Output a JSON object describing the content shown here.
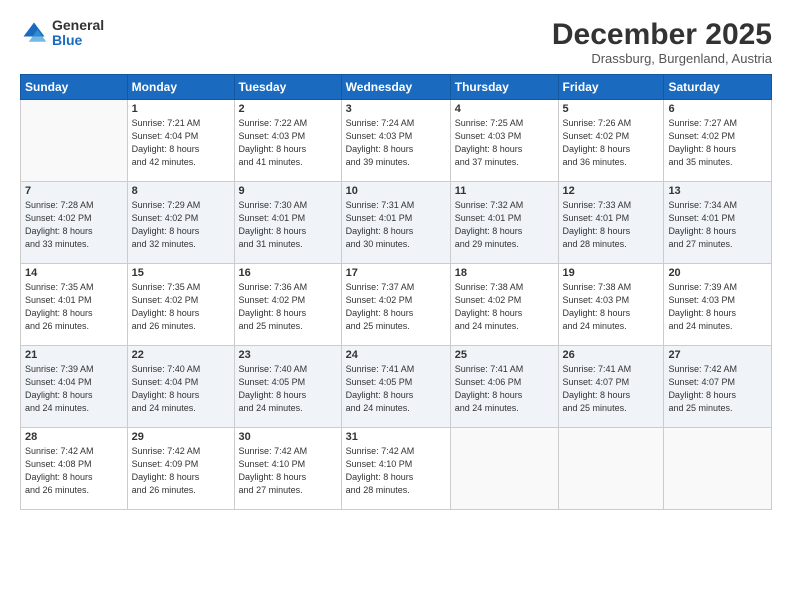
{
  "logo": {
    "general": "General",
    "blue": "Blue"
  },
  "header": {
    "month": "December 2025",
    "location": "Drassburg, Burgenland, Austria"
  },
  "weekdays": [
    "Sunday",
    "Monday",
    "Tuesday",
    "Wednesday",
    "Thursday",
    "Friday",
    "Saturday"
  ],
  "weeks": [
    [
      {
        "day": "",
        "info": ""
      },
      {
        "day": "1",
        "info": "Sunrise: 7:21 AM\nSunset: 4:04 PM\nDaylight: 8 hours\nand 42 minutes."
      },
      {
        "day": "2",
        "info": "Sunrise: 7:22 AM\nSunset: 4:03 PM\nDaylight: 8 hours\nand 41 minutes."
      },
      {
        "day": "3",
        "info": "Sunrise: 7:24 AM\nSunset: 4:03 PM\nDaylight: 8 hours\nand 39 minutes."
      },
      {
        "day": "4",
        "info": "Sunrise: 7:25 AM\nSunset: 4:03 PM\nDaylight: 8 hours\nand 37 minutes."
      },
      {
        "day": "5",
        "info": "Sunrise: 7:26 AM\nSunset: 4:02 PM\nDaylight: 8 hours\nand 36 minutes."
      },
      {
        "day": "6",
        "info": "Sunrise: 7:27 AM\nSunset: 4:02 PM\nDaylight: 8 hours\nand 35 minutes."
      }
    ],
    [
      {
        "day": "7",
        "info": "Sunrise: 7:28 AM\nSunset: 4:02 PM\nDaylight: 8 hours\nand 33 minutes."
      },
      {
        "day": "8",
        "info": "Sunrise: 7:29 AM\nSunset: 4:02 PM\nDaylight: 8 hours\nand 32 minutes."
      },
      {
        "day": "9",
        "info": "Sunrise: 7:30 AM\nSunset: 4:01 PM\nDaylight: 8 hours\nand 31 minutes."
      },
      {
        "day": "10",
        "info": "Sunrise: 7:31 AM\nSunset: 4:01 PM\nDaylight: 8 hours\nand 30 minutes."
      },
      {
        "day": "11",
        "info": "Sunrise: 7:32 AM\nSunset: 4:01 PM\nDaylight: 8 hours\nand 29 minutes."
      },
      {
        "day": "12",
        "info": "Sunrise: 7:33 AM\nSunset: 4:01 PM\nDaylight: 8 hours\nand 28 minutes."
      },
      {
        "day": "13",
        "info": "Sunrise: 7:34 AM\nSunset: 4:01 PM\nDaylight: 8 hours\nand 27 minutes."
      }
    ],
    [
      {
        "day": "14",
        "info": "Sunrise: 7:35 AM\nSunset: 4:01 PM\nDaylight: 8 hours\nand 26 minutes."
      },
      {
        "day": "15",
        "info": "Sunrise: 7:35 AM\nSunset: 4:02 PM\nDaylight: 8 hours\nand 26 minutes."
      },
      {
        "day": "16",
        "info": "Sunrise: 7:36 AM\nSunset: 4:02 PM\nDaylight: 8 hours\nand 25 minutes."
      },
      {
        "day": "17",
        "info": "Sunrise: 7:37 AM\nSunset: 4:02 PM\nDaylight: 8 hours\nand 25 minutes."
      },
      {
        "day": "18",
        "info": "Sunrise: 7:38 AM\nSunset: 4:02 PM\nDaylight: 8 hours\nand 24 minutes."
      },
      {
        "day": "19",
        "info": "Sunrise: 7:38 AM\nSunset: 4:03 PM\nDaylight: 8 hours\nand 24 minutes."
      },
      {
        "day": "20",
        "info": "Sunrise: 7:39 AM\nSunset: 4:03 PM\nDaylight: 8 hours\nand 24 minutes."
      }
    ],
    [
      {
        "day": "21",
        "info": "Sunrise: 7:39 AM\nSunset: 4:04 PM\nDaylight: 8 hours\nand 24 minutes."
      },
      {
        "day": "22",
        "info": "Sunrise: 7:40 AM\nSunset: 4:04 PM\nDaylight: 8 hours\nand 24 minutes."
      },
      {
        "day": "23",
        "info": "Sunrise: 7:40 AM\nSunset: 4:05 PM\nDaylight: 8 hours\nand 24 minutes."
      },
      {
        "day": "24",
        "info": "Sunrise: 7:41 AM\nSunset: 4:05 PM\nDaylight: 8 hours\nand 24 minutes."
      },
      {
        "day": "25",
        "info": "Sunrise: 7:41 AM\nSunset: 4:06 PM\nDaylight: 8 hours\nand 24 minutes."
      },
      {
        "day": "26",
        "info": "Sunrise: 7:41 AM\nSunset: 4:07 PM\nDaylight: 8 hours\nand 25 minutes."
      },
      {
        "day": "27",
        "info": "Sunrise: 7:42 AM\nSunset: 4:07 PM\nDaylight: 8 hours\nand 25 minutes."
      }
    ],
    [
      {
        "day": "28",
        "info": "Sunrise: 7:42 AM\nSunset: 4:08 PM\nDaylight: 8 hours\nand 26 minutes."
      },
      {
        "day": "29",
        "info": "Sunrise: 7:42 AM\nSunset: 4:09 PM\nDaylight: 8 hours\nand 26 minutes."
      },
      {
        "day": "30",
        "info": "Sunrise: 7:42 AM\nSunset: 4:10 PM\nDaylight: 8 hours\nand 27 minutes."
      },
      {
        "day": "31",
        "info": "Sunrise: 7:42 AM\nSunset: 4:10 PM\nDaylight: 8 hours\nand 28 minutes."
      },
      {
        "day": "",
        "info": ""
      },
      {
        "day": "",
        "info": ""
      },
      {
        "day": "",
        "info": ""
      }
    ]
  ]
}
